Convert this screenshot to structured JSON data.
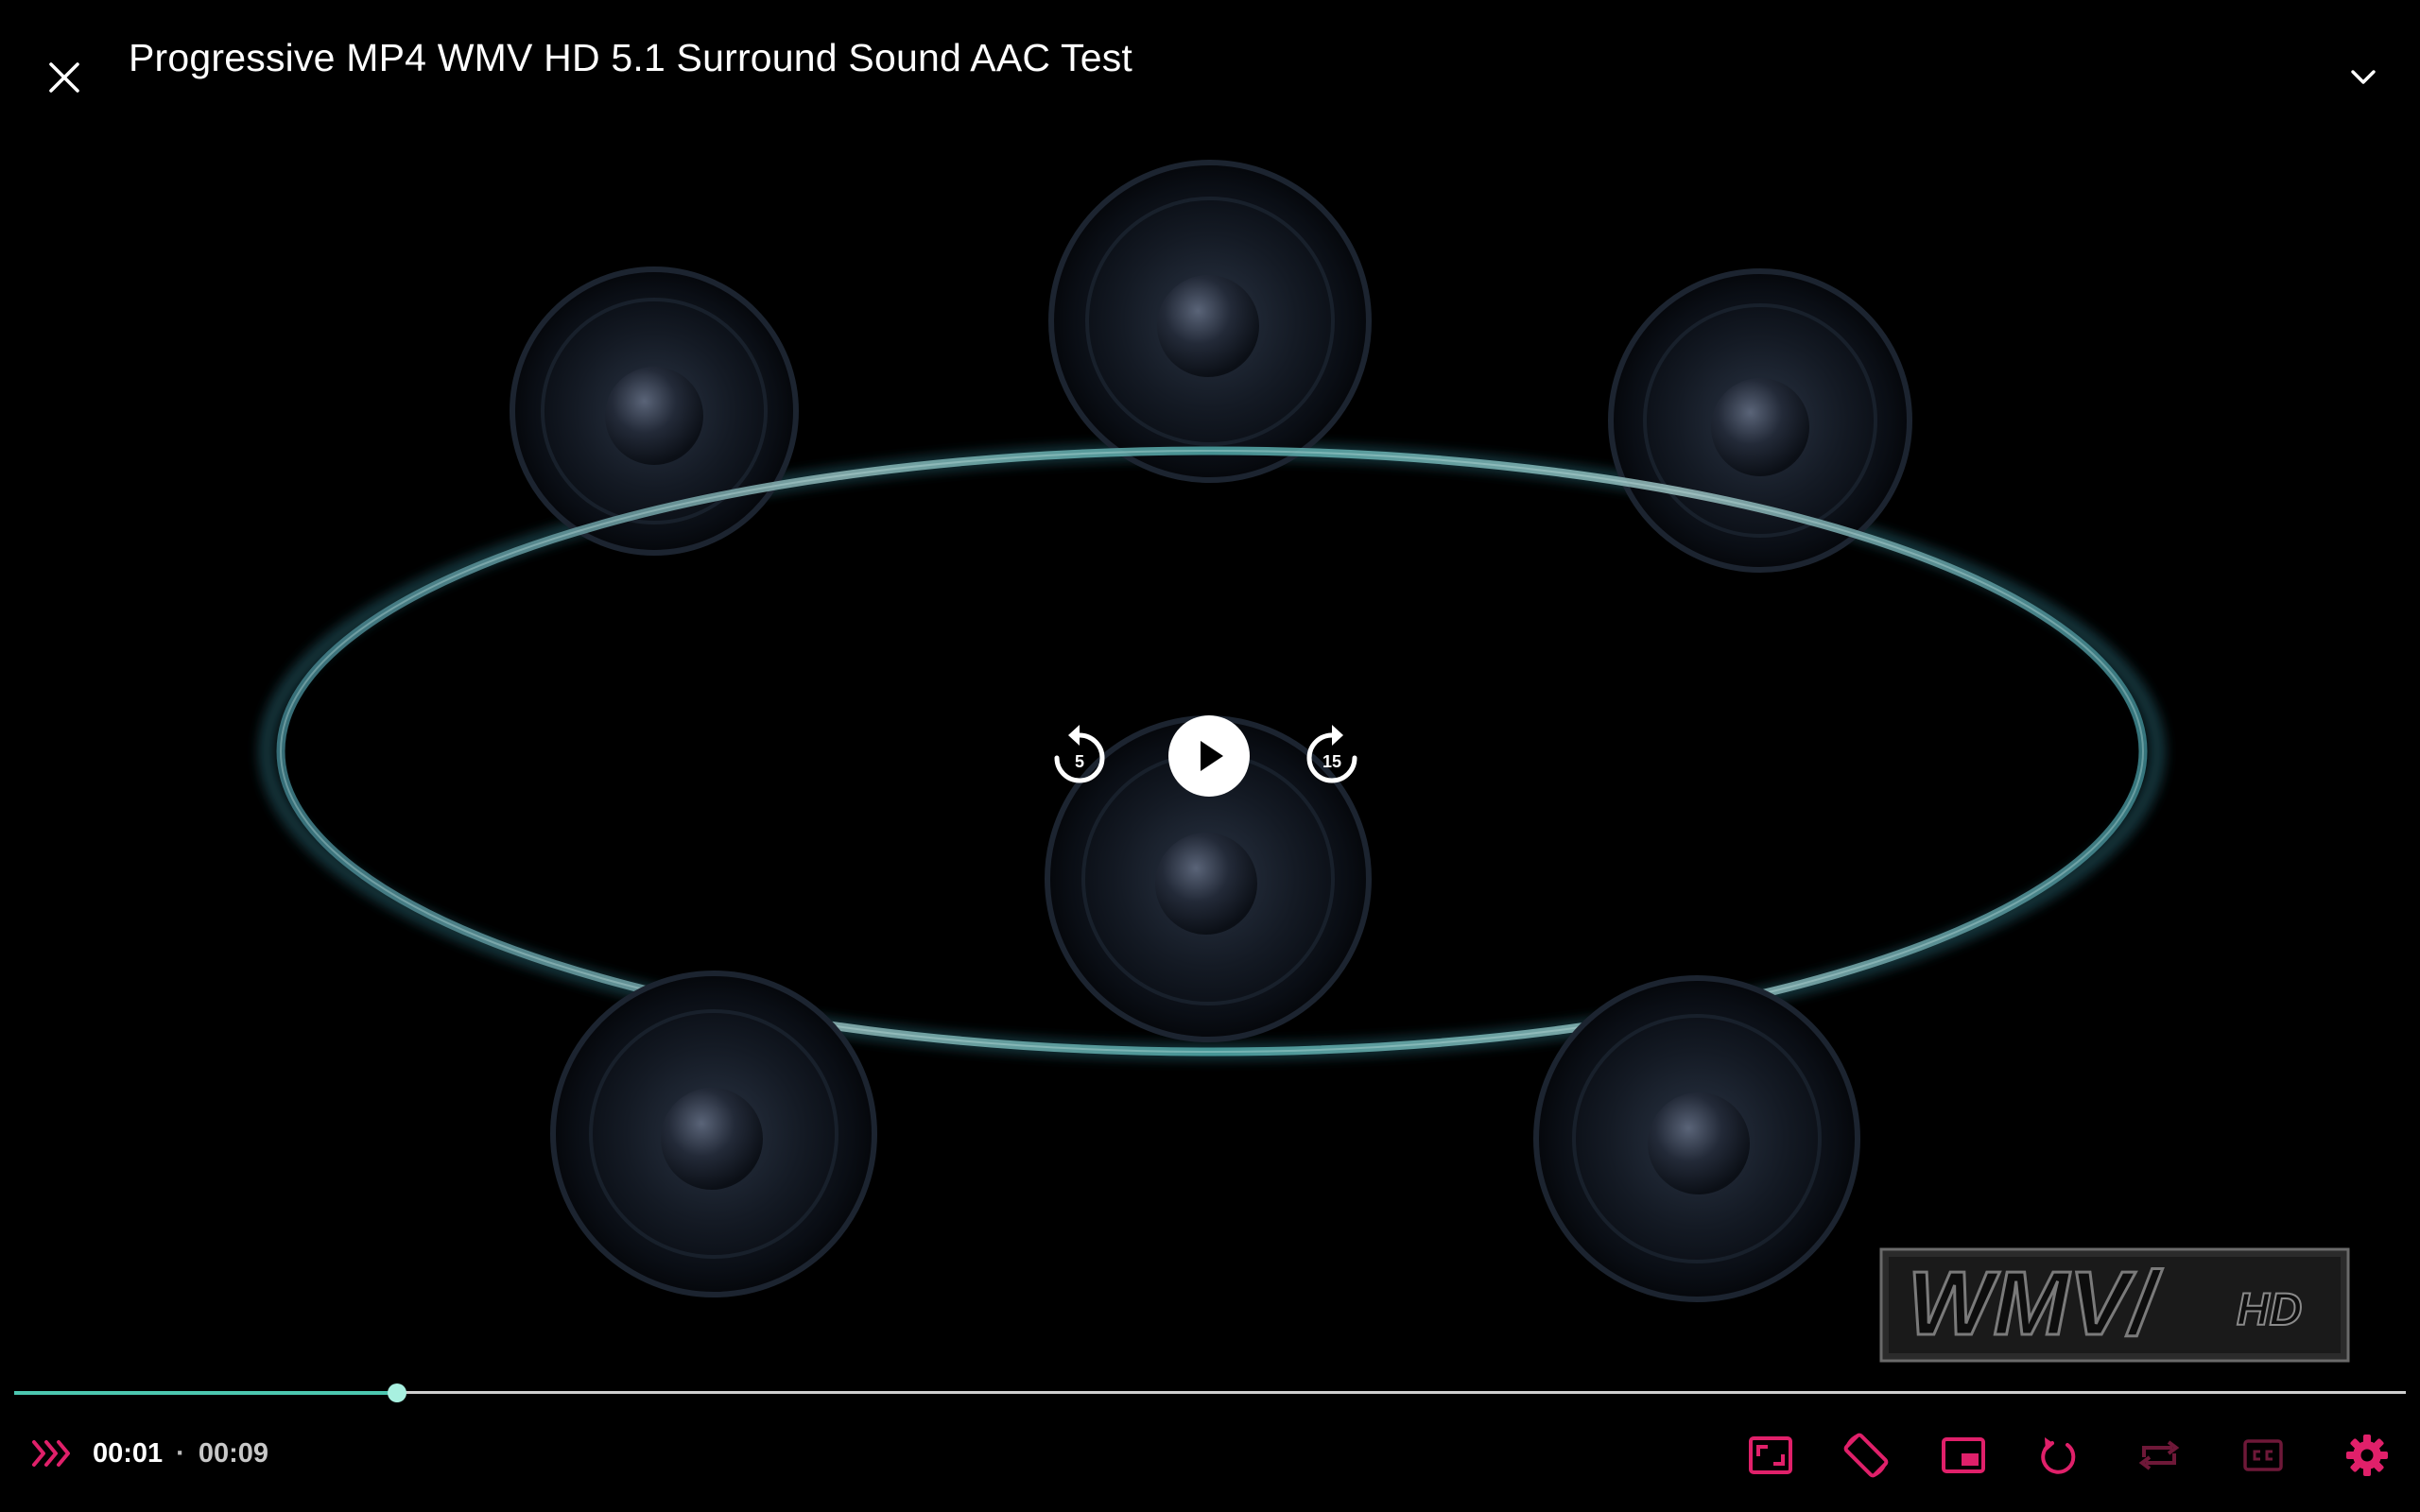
{
  "header": {
    "title": "Progressive MP4 WMV HD 5.1 Surround Sound AAC Test"
  },
  "controls": {
    "rewind_seconds": "5",
    "forward_seconds": "15"
  },
  "playback": {
    "current_time": "00:01",
    "separator": "·",
    "duration": "00:09",
    "progress_fraction": 0.16
  },
  "watermark": {
    "logo_text": "WMV HD"
  },
  "icons": {
    "close": "close-icon",
    "collapse": "chevron-down-icon",
    "rewind": "replay-5-icon",
    "play": "play-icon",
    "forward": "forward-15-icon",
    "speed": "playback-speed-icon",
    "aspect": "aspect-ratio-icon",
    "rotate": "screen-rotation-icon",
    "pip": "picture-in-picture-icon",
    "replay": "replay-icon",
    "repeat": "repeat-icon",
    "captions": "closed-captions-icon",
    "settings": "settings-gear-icon"
  },
  "colors": {
    "accent": "#e0206a",
    "accent_dim": "#6e1838",
    "progress": "#4cc7b0",
    "progress_thumb": "#a8f0e0",
    "background": "#000000"
  }
}
